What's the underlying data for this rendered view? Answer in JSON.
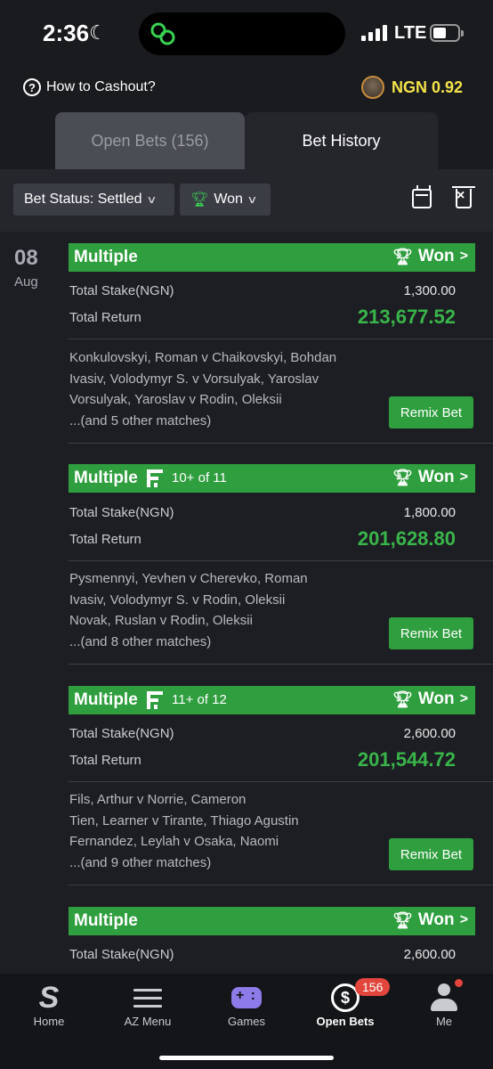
{
  "status_bar": {
    "time": "2:36",
    "network": "LTE"
  },
  "header": {
    "cashout_label": "How to Cashout?",
    "balance": "NGN 0.92"
  },
  "tabs": [
    {
      "label": "Open Bets (156)"
    },
    {
      "label": "Bet History"
    }
  ],
  "filters": {
    "status": "Bet Status: Settled",
    "result": "Won"
  },
  "date": {
    "day": "08",
    "month": "Aug"
  },
  "bets": [
    {
      "type": "Multiple",
      "qualifier": "",
      "result": "Won",
      "stake_label": "Total Stake(NGN)",
      "stake": "1,300.00",
      "return_label": "Total Return",
      "return": "213,677.52",
      "matches": [
        "Konkulovskyi, Roman v Chaikovskyi, Bohdan",
        "Ivasiv, Volodymyr S. v Vorsulyak, Yaroslav",
        "Vorsulyak, Yaroslav v Rodin, Oleksii",
        "...(and 5 other matches)"
      ],
      "remix_label": "Remix Bet"
    },
    {
      "type": "Multiple",
      "qualifier": "10+ of 11",
      "result": "Won",
      "stake_label": "Total Stake(NGN)",
      "stake": "1,800.00",
      "return_label": "Total Return",
      "return": "201,628.80",
      "matches": [
        "Pysmennyi, Yevhen v Cherevko, Roman",
        "Ivasiv, Volodymyr S. v Rodin, Oleksii",
        "Novak, Ruslan v Rodin, Oleksii",
        "...(and 8 other matches)"
      ],
      "remix_label": "Remix Bet"
    },
    {
      "type": "Multiple",
      "qualifier": "11+ of 12",
      "result": "Won",
      "stake_label": "Total Stake(NGN)",
      "stake": "2,600.00",
      "return_label": "Total Return",
      "return": "201,544.72",
      "matches": [
        "Fils, Arthur v Norrie, Cameron",
        "Tien, Learner v Tirante, Thiago Agustin",
        "Fernandez, Leylah v Osaka, Naomi",
        "...(and 9 other matches)"
      ],
      "remix_label": "Remix Bet"
    },
    {
      "type": "Multiple",
      "result": "Won",
      "stake_label": "Total Stake(NGN)",
      "stake": "2,600.00"
    }
  ],
  "bottom_nav": [
    {
      "label": "Home",
      "icon": "home-s-icon"
    },
    {
      "label": "AZ Menu",
      "icon": "menu-icon"
    },
    {
      "label": "Games",
      "icon": "gamepad-icon"
    },
    {
      "label": "Open Bets",
      "icon": "open-bets-icon",
      "badge": "156"
    },
    {
      "label": "Me",
      "icon": "user-icon"
    }
  ],
  "colors": {
    "accent_green": "#2f9e3e",
    "return_green": "#39b54a",
    "balance_yellow": "#f4e34a",
    "badge_red": "#e2453c"
  }
}
